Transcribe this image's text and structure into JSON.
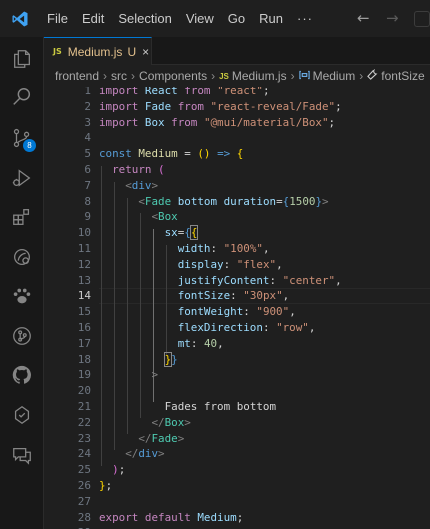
{
  "menu": {
    "file": "File",
    "edit": "Edit",
    "selection": "Selection",
    "view": "View",
    "go": "Go",
    "run": "Run",
    "more": "···"
  },
  "tab": {
    "icon_text": "JS",
    "filename": "Medium.js",
    "modified": "U",
    "close": "×"
  },
  "breadcrumb": {
    "items": [
      "frontend",
      "src",
      "Components"
    ],
    "file_icon": "JS",
    "file": "Medium.js",
    "symbol": "Medium",
    "property": "fontSize"
  },
  "editor": {
    "active_line": 14
  },
  "activity_badge": "8",
  "icons": [
    "explorer-icon",
    "search-icon",
    "source-control-icon",
    "run-debug-icon",
    "extensions-icon",
    "remote-icon",
    "paw-icon",
    "gitlens-icon",
    "github-icon",
    "graph-icon",
    "comments-icon"
  ]
}
